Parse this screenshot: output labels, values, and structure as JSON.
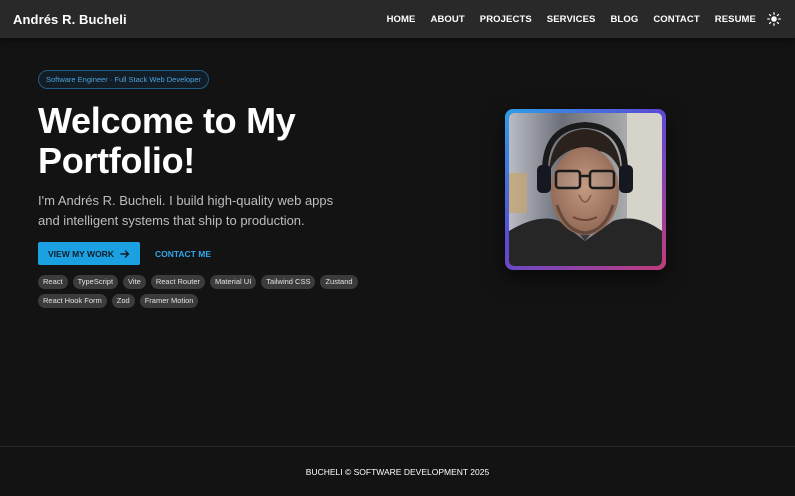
{
  "header": {
    "brand": "Andrés R. Bucheli",
    "nav": [
      "HOME",
      "ABOUT",
      "PROJECTS",
      "SERVICES",
      "BLOG",
      "CONTACT",
      "RESUME"
    ],
    "theme_toggle_icon": "sun-icon"
  },
  "hero": {
    "role": "Software Engineer · Full Stack Web Developer",
    "title": "Welcome to My Portfolio!",
    "subtitle": "I'm Andrés R. Bucheli. I build high-quality web apps and intelligent systems that ship to production.",
    "primary_cta": "VIEW MY WORK",
    "primary_cta_icon": "arrow-right-icon",
    "secondary_cta": "CONTACT ME",
    "tech": [
      "React",
      "TypeScript",
      "Vite",
      "React Router",
      "Material UI",
      "Tailwind CSS",
      "Zustand",
      "React Hook Form",
      "Zod",
      "Framer Motion"
    ],
    "portrait_icon": "profile-photo"
  },
  "footer": {
    "text": "BUCHELI © SOFTWARE DEVELOPMENT 2025"
  },
  "colors": {
    "background": "#131313",
    "navbar": "#292929",
    "accent": "#1ba1e2",
    "chip_border": "#1f5d86",
    "tag_bg": "#3b3b3b"
  }
}
